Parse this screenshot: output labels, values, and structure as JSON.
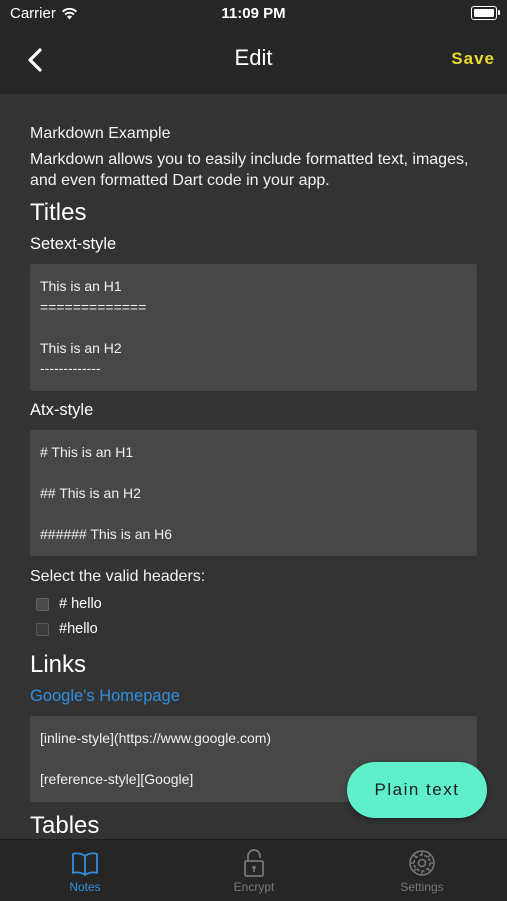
{
  "status_bar": {
    "carrier": "Carrier",
    "time": "11:09 PM"
  },
  "nav": {
    "title": "Edit",
    "save_label": "Save"
  },
  "content": {
    "intro_title": "Markdown Example",
    "intro_text": "Markdown allows you to easily include formatted text, images, and even formatted Dart code in your app.",
    "titles_heading": "Titles",
    "setext_label": "Setext-style",
    "setext_lines": [
      "This is an H1",
      "=============",
      "",
      "This is an H2",
      "-------------"
    ],
    "atx_label": "Atx-style",
    "atx_lines": [
      "# This is an H1",
      "",
      "## This is an H2",
      "",
      "###### This is an H6"
    ],
    "select_label": "Select the valid headers:",
    "checkbox_1": "# hello",
    "checkbox_2": "#hello",
    "links_heading": "Links",
    "google_link": "Google's Homepage",
    "link_lines": [
      "[inline-style](https://www.google.com)",
      "",
      "[reference-style][Google]"
    ],
    "tables_heading": "Tables"
  },
  "fab": {
    "label": "Plain text"
  },
  "tabs": [
    {
      "label": "Notes",
      "icon": "book-icon"
    },
    {
      "label": "Encrypt",
      "icon": "lock-icon"
    },
    {
      "label": "Settings",
      "icon": "gear-icon"
    }
  ],
  "colors": {
    "accent": "#2f8fe0",
    "save": "#e6db2e",
    "fab": "#5ff0cb",
    "background": "#333333",
    "bar": "#262626"
  }
}
